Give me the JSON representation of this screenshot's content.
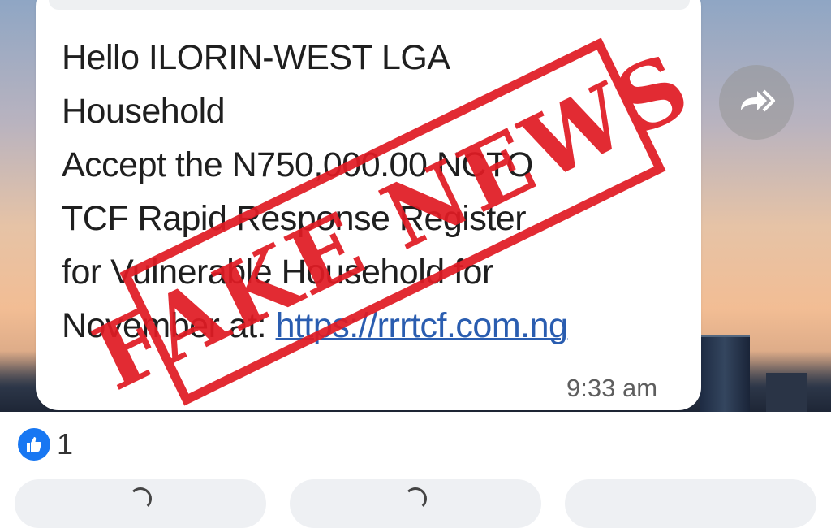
{
  "message": {
    "lines": [
      "Hello ILORIN-WEST LGA",
      "Household",
      "Accept the N750,000.00 NCTO",
      "TCF Rapid Response Register",
      "for Vulnerable Household for",
      "November at: "
    ],
    "link": "https://rrrtcf.com.ng",
    "time": "9:33 am"
  },
  "stamp": {
    "text": "FAKE NEWS",
    "color": "#e01b24"
  },
  "reactions": {
    "icon": "thumbs-up-icon",
    "count": "1",
    "color": "#1877f2"
  },
  "icons": {
    "forward": "forward-arrow-icon"
  }
}
